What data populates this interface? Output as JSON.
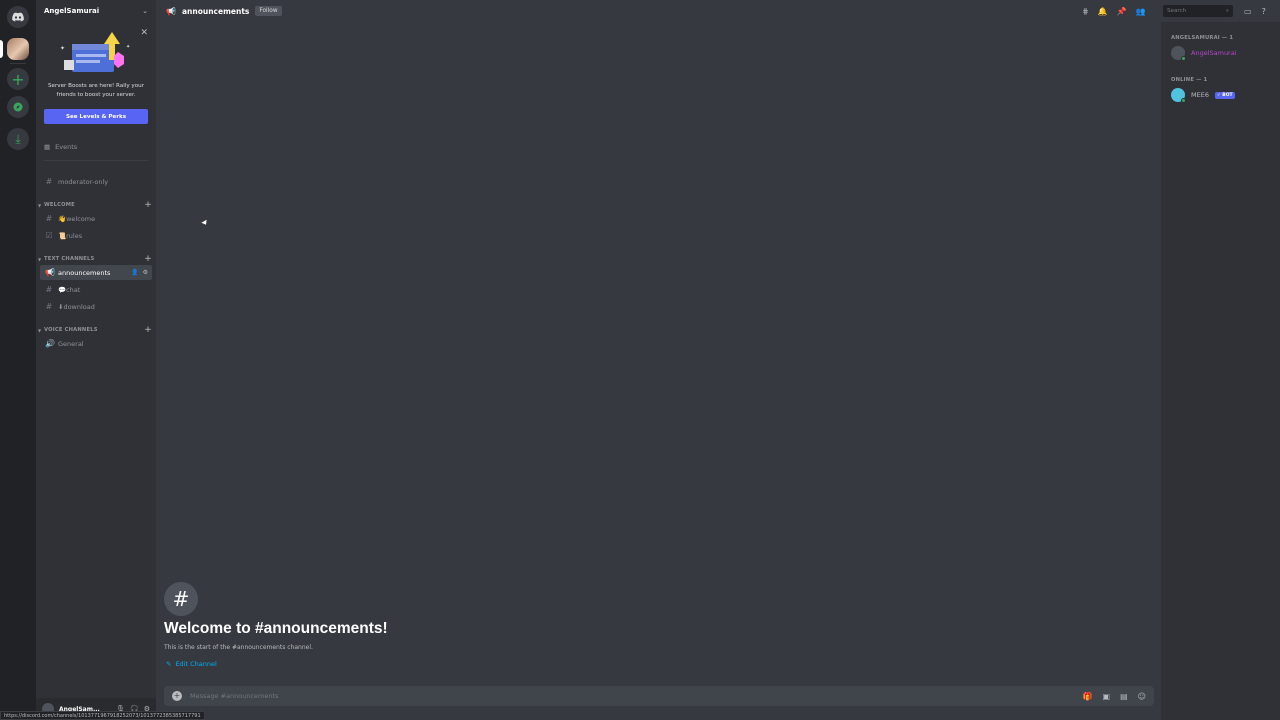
{
  "sidebar": {
    "server_name": "AngelSamurai",
    "boost_text": "Server Boosts are here! Rally your friends to boost your server.",
    "boost_button": "See Levels & Perks",
    "events_label": "Events",
    "channels": {
      "moderator": "moderator-only",
      "welcome": "👋welcome",
      "rules": "📜rules",
      "announcements": "announcements",
      "chat": "💬chat",
      "download": "⬇download",
      "general": "General"
    },
    "categories": {
      "welcome": "WELCOME",
      "text": "TEXT CHANNELS",
      "voice": "VOICE CHANNELS"
    },
    "user": {
      "name": "AngelSam..."
    },
    "status_url": "https://discord.com/channels/1013771967918252073/1013772385385717791"
  },
  "topbar": {
    "channel_name": "announcements",
    "follow_label": "Follow",
    "search_placeholder": "Search"
  },
  "main": {
    "welcome_title": "Welcome to #announcements!",
    "welcome_subtitle": "This is the start of the #announcements channel.",
    "edit_channel": "Edit Channel",
    "message_placeholder": "Message #announcements"
  },
  "members": {
    "group_owner": "ANGELSAMURAI — 1",
    "group_online": "ONLINE — 1",
    "owner_name": "AngelSamurai",
    "bot_name": "MEE6",
    "bot_tag": "✓ BOT"
  },
  "colors": {
    "accent": "#5865f2",
    "online": "#3ba55d",
    "owner_name": "#b845c9",
    "link": "#00aff4"
  }
}
